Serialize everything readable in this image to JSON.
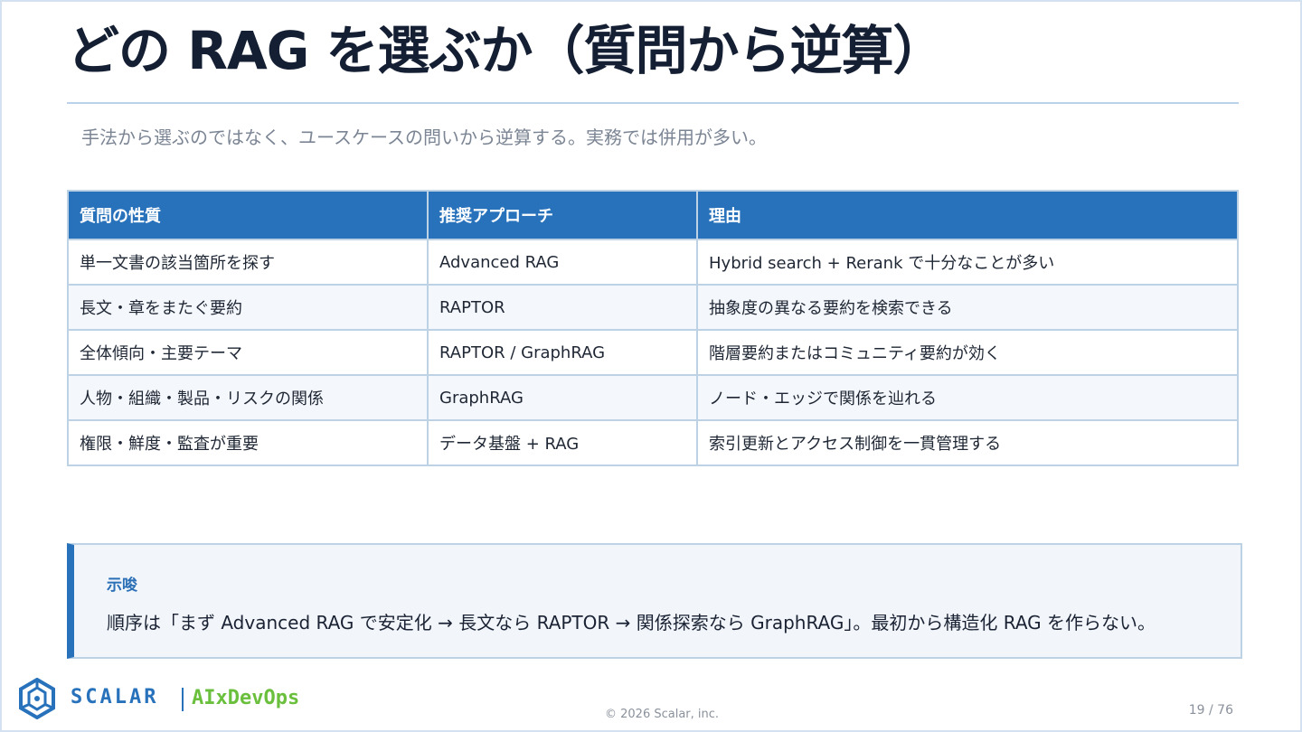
{
  "title": "どの RAG を選ぶか（質問から逆算）",
  "subtitle": "手法から選ぶのではなく、ユースケースの問いから逆算する。実務では併用が多い。",
  "table": {
    "headers": [
      "質問の性質",
      "推奨アプローチ",
      "理由"
    ],
    "rows": [
      [
        "単一文書の該当箇所を探す",
        "Advanced RAG",
        "Hybrid search + Rerank で十分なことが多い"
      ],
      [
        "長文・章をまたぐ要約",
        "RAPTOR",
        "抽象度の異なる要約を検索できる"
      ],
      [
        "全体傾向・主要テーマ",
        "RAPTOR / GraphRAG",
        "階層要約またはコミュニティ要約が効く"
      ],
      [
        "人物・組織・製品・リスクの関係",
        "GraphRAG",
        "ノード・エッジで関係を辿れる"
      ],
      [
        "権限・鮮度・監査が重要",
        "データ基盤 + RAG",
        "索引更新とアクセス制御を一貫管理する"
      ]
    ]
  },
  "note": {
    "label": "示唆",
    "text": "順序は「まず Advanced RAG で安定化 → 長文なら RAPTOR → 関係探索なら GraphRAG」。最初から構造化 RAG を作らない。"
  },
  "footer": {
    "brand": "SCALAR",
    "product": "AIxDevOps",
    "copyright": "© 2026 Scalar, inc.",
    "page": "19 / 76",
    "logo_icon": "scalar-hexagon-logo"
  },
  "colors": {
    "accent": "#2872bc",
    "header_bg": "#2872bc",
    "border": "#bed2e6",
    "product_green": "#6abf3d",
    "note_bg": "#f2f6fb"
  }
}
